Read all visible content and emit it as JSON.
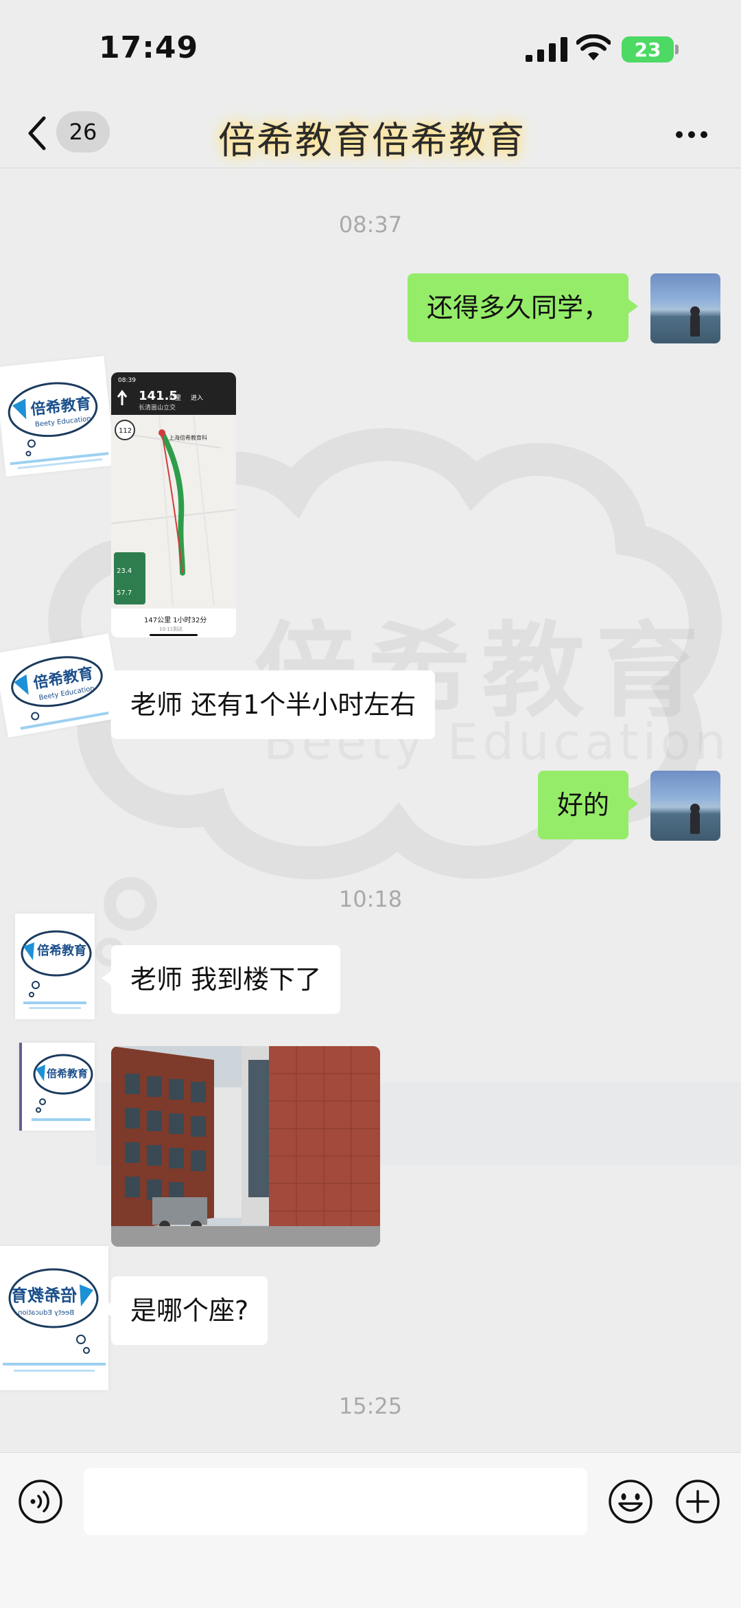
{
  "status_bar": {
    "time": "17:49",
    "battery": "23",
    "icons": [
      "cellular-signal-icon",
      "wifi-icon",
      "battery-charging-icon"
    ]
  },
  "nav": {
    "back_icon": "chevron-left-icon",
    "unread_count": "26",
    "title": "倍希教育倍希教育",
    "more_icon": "more-horizontal-icon"
  },
  "messages": [
    {
      "type": "timestamp",
      "text": "08:37"
    },
    {
      "type": "text",
      "side": "out",
      "text": "还得多久同学，"
    },
    {
      "type": "image",
      "side": "in",
      "content": "map-navigation-screenshot",
      "map": {
        "status_time": "08:39",
        "distance": "141.5",
        "distance_unit": "公里",
        "action": "进入",
        "road": "长清崮山立交",
        "speed_limit": "112",
        "destination": "上海倍希教育科",
        "panel_distance_1": "23.4",
        "panel_distance_2": "57.7",
        "summary": "147公里 1小时32分",
        "arrival": "10:11到达"
      }
    },
    {
      "type": "text",
      "side": "in",
      "text": "老师 还有1个半小时左右"
    },
    {
      "type": "text",
      "side": "out",
      "text": "好的"
    },
    {
      "type": "timestamp",
      "text": "10:18"
    },
    {
      "type": "text",
      "side": "in",
      "text": "老师 我到楼下了"
    },
    {
      "type": "image",
      "side": "in",
      "content": "building-photo"
    },
    {
      "type": "text",
      "side": "in",
      "text": "是哪个座?"
    },
    {
      "type": "timestamp",
      "text": "15:25"
    }
  ],
  "brand": {
    "logo_text": "倍希教育",
    "logo_sub": "Beety Education"
  },
  "watermark": {
    "text": "倍希教育",
    "sub": "Beety Education"
  },
  "input_bar": {
    "voice_icon": "voice-icon",
    "placeholder": "",
    "emoji_icon": "emoji-icon",
    "add_icon": "plus-circle-icon"
  },
  "colors": {
    "background": "#ededed",
    "outgoing_bubble": "#95ec69",
    "incoming_bubble": "#ffffff",
    "battery": "#4cd964"
  }
}
